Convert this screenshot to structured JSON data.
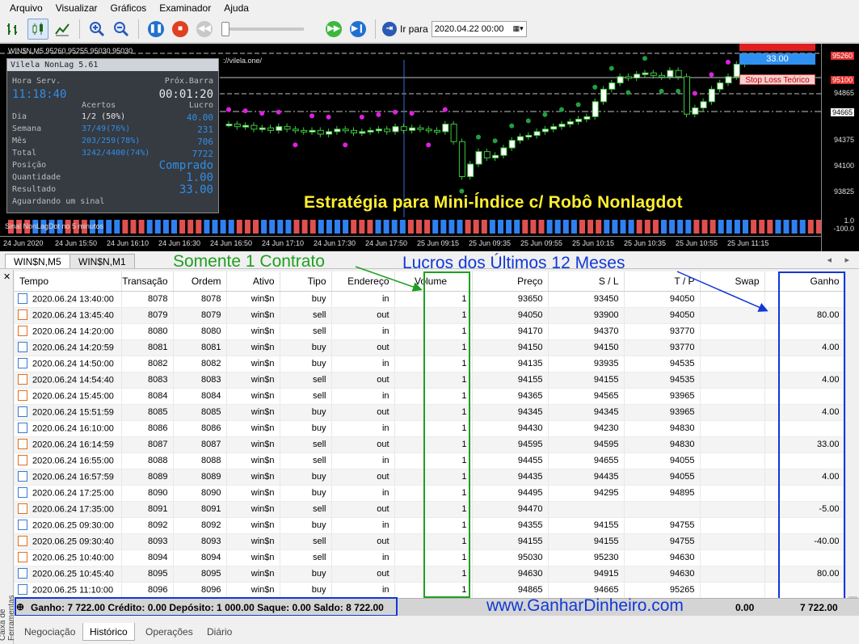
{
  "menu": [
    "Arquivo",
    "Visualizar",
    "Gráficos",
    "Examinador",
    "Ajuda"
  ],
  "toolbar": {
    "goto_label": "Ir para",
    "goto_value": "2020.04.22 00:00"
  },
  "chart": {
    "symbol_header": "WIN$N,M5  95260 95255 95030 95030",
    "url_text": "://vilela.one/",
    "title": "Estratégia para Mini-Índice c/ Robô Nonlagdot",
    "signal_label": "Sinal NonLagDot no 5 minutos",
    "price_ticks": [
      "95260",
      "95100",
      "94865",
      "94665",
      "94375",
      "94100",
      "93825",
      "1.0",
      "-100.0"
    ],
    "time_ticks": [
      "24 Jun 2020",
      "24 Jun 15:50",
      "24 Jun 16:10",
      "24 Jun 16:30",
      "24 Jun 16:50",
      "24 Jun 17:10",
      "24 Jun 17:30",
      "24 Jun 17:50",
      "25 Jun 09:15",
      "25 Jun 09:35",
      "25 Jun 09:55",
      "25 Jun 10:15",
      "25 Jun 10:35",
      "25 Jun 10:55",
      "25 Jun 11:15"
    ],
    "tag_value": "33.00",
    "tag_stop": "Stop Loss Teórico"
  },
  "panel": {
    "title": "Vilela NonLag 5.61",
    "hora_label": "Hora Serv.",
    "hora_value": "11:18:40",
    "prox_label": "Próx.Barra",
    "prox_value": "00:01:20",
    "acertos": "Acertos",
    "lucro": "Lucro",
    "rows": [
      {
        "label": "Dia",
        "ratio": "1/2 (50%)",
        "value": "40.00"
      },
      {
        "label": "Semana",
        "ratio": "37/49(76%)",
        "value": "231"
      },
      {
        "label": "Mês",
        "ratio": "203/259(78%)",
        "value": "706"
      },
      {
        "label": "Total",
        "ratio": "3242/4400(74%)",
        "value": "7722"
      }
    ],
    "posicao_label": "Posição",
    "posicao_value": "Comprado",
    "quantidade_label": "Quantidade",
    "quantidade_value": "1.00",
    "resultado_label": "Resultado",
    "resultado_value": "33.00",
    "status": "Aguardando um sinal"
  },
  "symbol_tabs": [
    "WIN$N,M5",
    "WIN$N,M1"
  ],
  "annotations": {
    "contract": "Somente 1 Contrato",
    "profits": "Lucros dos Últimos 12 Meses",
    "site": "www.GanharDinheiro.com"
  },
  "columns": [
    "Tempo",
    "Transação",
    "Ordem",
    "Ativo",
    "Tipo",
    "Endereço",
    "Volume",
    "Preço",
    "S / L",
    "T / P",
    "Swap",
    "Ganho"
  ],
  "rows": [
    [
      "2020.06.24 13:40:00",
      "8078",
      "8078",
      "win$n",
      "buy",
      "in",
      "1",
      "93650",
      "93450",
      "94050",
      "",
      ""
    ],
    [
      "2020.06.24 13:45:40",
      "8079",
      "8079",
      "win$n",
      "sell",
      "out",
      "1",
      "94050",
      "93900",
      "94050",
      "",
      "80.00"
    ],
    [
      "2020.06.24 14:20:00",
      "8080",
      "8080",
      "win$n",
      "sell",
      "in",
      "1",
      "94170",
      "94370",
      "93770",
      "",
      ""
    ],
    [
      "2020.06.24 14:20:59",
      "8081",
      "8081",
      "win$n",
      "buy",
      "out",
      "1",
      "94150",
      "94150",
      "93770",
      "",
      "4.00"
    ],
    [
      "2020.06.24 14:50:00",
      "8082",
      "8082",
      "win$n",
      "buy",
      "in",
      "1",
      "94135",
      "93935",
      "94535",
      "",
      ""
    ],
    [
      "2020.06.24 14:54:40",
      "8083",
      "8083",
      "win$n",
      "sell",
      "out",
      "1",
      "94155",
      "94155",
      "94535",
      "",
      "4.00"
    ],
    [
      "2020.06.24 15:45:00",
      "8084",
      "8084",
      "win$n",
      "sell",
      "in",
      "1",
      "94365",
      "94565",
      "93965",
      "",
      ""
    ],
    [
      "2020.06.24 15:51:59",
      "8085",
      "8085",
      "win$n",
      "buy",
      "out",
      "1",
      "94345",
      "94345",
      "93965",
      "",
      "4.00"
    ],
    [
      "2020.06.24 16:10:00",
      "8086",
      "8086",
      "win$n",
      "buy",
      "in",
      "1",
      "94430",
      "94230",
      "94830",
      "",
      ""
    ],
    [
      "2020.06.24 16:14:59",
      "8087",
      "8087",
      "win$n",
      "sell",
      "out",
      "1",
      "94595",
      "94595",
      "94830",
      "",
      "33.00"
    ],
    [
      "2020.06.24 16:55:00",
      "8088",
      "8088",
      "win$n",
      "sell",
      "in",
      "1",
      "94455",
      "94655",
      "94055",
      "",
      ""
    ],
    [
      "2020.06.24 16:57:59",
      "8089",
      "8089",
      "win$n",
      "buy",
      "out",
      "1",
      "94435",
      "94435",
      "94055",
      "",
      "4.00"
    ],
    [
      "2020.06.24 17:25:00",
      "8090",
      "8090",
      "win$n",
      "buy",
      "in",
      "1",
      "94495",
      "94295",
      "94895",
      "",
      ""
    ],
    [
      "2020.06.24 17:35:00",
      "8091",
      "8091",
      "win$n",
      "sell",
      "out",
      "1",
      "94470",
      "",
      "",
      "",
      "-5.00"
    ],
    [
      "2020.06.25 09:30:00",
      "8092",
      "8092",
      "win$n",
      "buy",
      "in",
      "1",
      "94355",
      "94155",
      "94755",
      "",
      ""
    ],
    [
      "2020.06.25 09:30:40",
      "8093",
      "8093",
      "win$n",
      "sell",
      "out",
      "1",
      "94155",
      "94155",
      "94755",
      "",
      "-40.00"
    ],
    [
      "2020.06.25 10:40:00",
      "8094",
      "8094",
      "win$n",
      "sell",
      "in",
      "1",
      "95030",
      "95230",
      "94630",
      "",
      ""
    ],
    [
      "2020.06.25 10:45:40",
      "8095",
      "8095",
      "win$n",
      "buy",
      "out",
      "1",
      "94630",
      "94915",
      "94630",
      "",
      "80.00"
    ],
    [
      "2020.06.25 11:10:00",
      "8096",
      "8096",
      "win$n",
      "buy",
      "in",
      "1",
      "94865",
      "94665",
      "95265",
      "",
      ""
    ]
  ],
  "summary": {
    "text": "Ganho: 7 722.00  Crédito: 0.00  Depósito: 1 000.00  Saque: 0.00  Saldo: 8 722.00",
    "swap": "0.00",
    "ganho": "7 722.00"
  },
  "toolbox_label": "Caixa de Ferramentas",
  "bottom_tabs": [
    "Negociação",
    "Histórico",
    "Operações",
    "Diário"
  ]
}
